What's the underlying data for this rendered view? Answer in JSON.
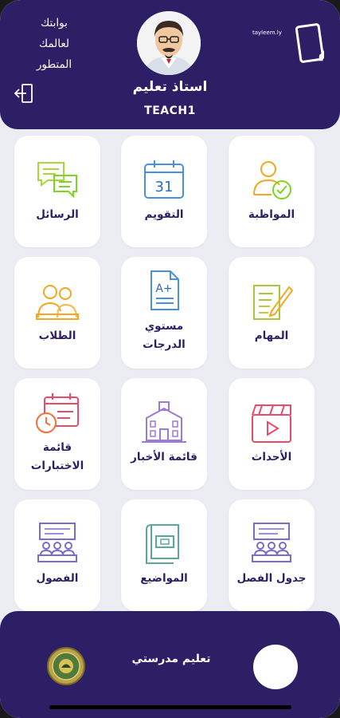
{
  "header": {
    "tagline": [
      "بوابتك",
      "لعالمك",
      "المتطور"
    ],
    "teacher_name": "استاذ تعليم",
    "teacher_id": "TEACH1",
    "logo_text": "تعليم",
    "logo_small": "tayleem.ly"
  },
  "tiles": [
    {
      "label": "المواظبة",
      "icon": "attendance-icon"
    },
    {
      "label": "التقويم",
      "icon": "calendar-icon",
      "icon_text": "31"
    },
    {
      "label": "الرسائل",
      "icon": "messages-icon"
    },
    {
      "label": "المهام",
      "icon": "tasks-icon"
    },
    {
      "label_lines": [
        "مستوي",
        "الدرجات"
      ],
      "icon": "grades-icon",
      "icon_text": "A+"
    },
    {
      "label": "الطلاب",
      "icon": "students-icon"
    },
    {
      "label": "الأحداث",
      "icon": "events-icon"
    },
    {
      "label": "قائمة الأخبار",
      "icon": "news-icon"
    },
    {
      "label_lines": [
        "قائمة",
        "الاختبارات"
      ],
      "icon": "exams-icon"
    },
    {
      "label": "جدول الفصل",
      "icon": "class-schedule-icon"
    },
    {
      "label": "المواضيع",
      "icon": "subjects-icon"
    },
    {
      "label": "الفصول",
      "icon": "classes-icon"
    }
  ],
  "bottom": {
    "app_name": "تعليم مدرستي"
  },
  "colors": {
    "primary": "#2c1f66",
    "background": "#ececf3",
    "accent_gradient_start": "#7ed321",
    "accent_gradient_end": "#f5a623"
  }
}
